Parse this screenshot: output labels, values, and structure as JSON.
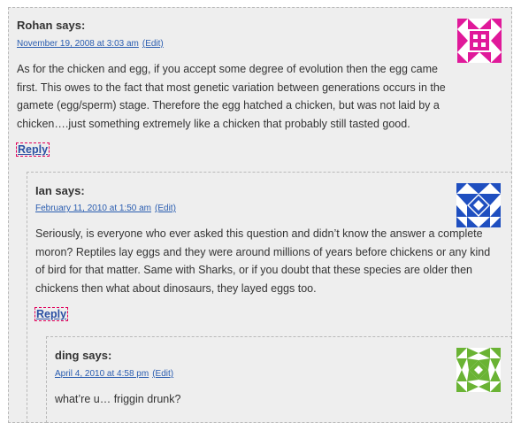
{
  "comments": [
    {
      "author": "Rohan",
      "says": "says:",
      "date": "November 19, 2008 at 3:03 am",
      "edit": "(Edit)",
      "text": "As for the chicken and egg, if you accept some degree of evolution then the egg came first. This owes to the fact that most genetic variation between generations occurs in the gamete (egg/sperm) stage. Therefore the egg hatched a chicken, but was not laid by a chicken….just something extremely like a chicken that probably still tasted good.",
      "reply": "Reply",
      "avatar_color": "#e0199a"
    },
    {
      "author": "Ian",
      "says": "says:",
      "date": "February 11, 2010 at 1:50 am",
      "edit": "(Edit)",
      "text": "Seriously, is everyone who ever asked this question and didn’t know the answer a complete moron? Reptiles lay eggs and they were around millions of years before chickens or any kind of bird for that matter. Same with Sharks, or if you doubt that these species are older then chickens then what about dinosaurs, they layed eggs too.",
      "reply": "Reply",
      "avatar_color": "#1f4fc0"
    },
    {
      "author": "ding",
      "says": "says:",
      "date": "April 4, 2010 at 4:58 pm",
      "edit": "(Edit)",
      "text": "what’re u… friggin drunk?",
      "avatar_color": "#6ab334"
    }
  ]
}
